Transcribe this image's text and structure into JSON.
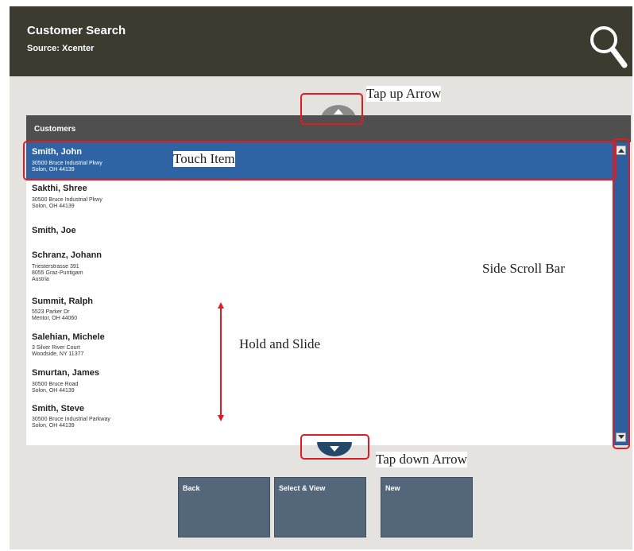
{
  "header": {
    "title": "Customer Search",
    "subtitle": "Source: Xcenter",
    "search_icon": "magnifier-icon"
  },
  "list": {
    "header": "Customers",
    "rows": [
      {
        "name": "Smith, John",
        "lines": [
          "30500 Bruce Industrial Pkwy",
          "Solon, OH 44139"
        ],
        "selected": true
      },
      {
        "name": "Sakthi, Shree",
        "lines": [
          "30500 Bruce Industrial Pkwy",
          "Solon, OH 44139"
        ]
      },
      {
        "name": "Smith, Joe",
        "lines": []
      },
      {
        "name": "Schranz, Johann",
        "lines": [
          "Triesterstrasse 391",
          "8055 Graz-Puntigam",
          "Austria"
        ]
      },
      {
        "name": "Summit, Ralph",
        "lines": [
          "5523 Parker Dr",
          "Mentor, OH 44060"
        ]
      },
      {
        "name": "Salehian, Michele",
        "lines": [
          "3 Silver River Court",
          "Woodside, NY 11377"
        ]
      },
      {
        "name": "Smurtan, James",
        "lines": [
          "30500 Bruce Road",
          "Solon, OH 44139"
        ]
      },
      {
        "name": "Smith, Steve",
        "lines": [
          "30500 Bruce Industrial Parkway",
          "Solon, OH 44139"
        ]
      }
    ]
  },
  "buttons": {
    "back": "Back",
    "select_view": "Select & View",
    "new": "New"
  },
  "callouts": {
    "tap_up": "Tap up Arrow",
    "touch_item": "Touch Item",
    "side_scroll": "Side Scroll Bar",
    "hold_slide": "Hold and Slide",
    "tap_down": "Tap down Arrow"
  },
  "colors": {
    "header_bg": "#3d3a30",
    "selected_row": "#2f64a4",
    "button_bg": "#54677a",
    "highlight": "#e01b24"
  }
}
